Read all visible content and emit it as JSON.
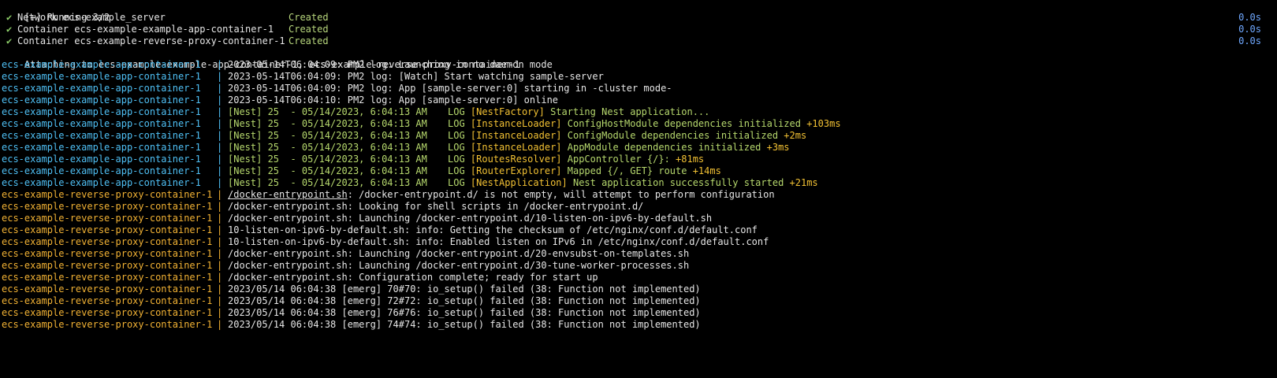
{
  "header": {
    "running": "[+] Running 3/2",
    "items": [
      {
        "check": "✔",
        "label": "Network ecs-example_server",
        "status": "Created",
        "time": "0.0s"
      },
      {
        "check": "✔",
        "label": "Container ecs-example-example-app-container-1",
        "status": "Created",
        "time": "0.0s"
      },
      {
        "check": "✔",
        "label": "Container ecs-example-reverse-proxy-container-1",
        "status": "Created",
        "time": "0.0s"
      }
    ],
    "attaching": "Attaching to ecs-example-example-app-container-1, ecs-example-reverse-proxy-container-1"
  },
  "app": {
    "container": "ecs-example-example-app-container-1",
    "pm2": [
      "2023-05-14T06:04:09: PM2 log: Launching in no daemon mode",
      "2023-05-14T06:04:09: PM2 log: [Watch] Start watching sample-server",
      "2023-05-14T06:04:09: PM2 log: App [sample-server:0] starting in -cluster mode-",
      "2023-05-14T06:04:10: PM2 log: App [sample-server:0] online"
    ],
    "nest_prefix": "[Nest] 25  - 05/14/2023, 6:04:13 AM",
    "nest": [
      {
        "level": "LOG",
        "ctx": "[NestFactory]",
        "text": "Starting Nest application...",
        "ms": ""
      },
      {
        "level": "LOG",
        "ctx": "[InstanceLoader]",
        "text": "ConfigHostModule dependencies initialized",
        "ms": "+103ms"
      },
      {
        "level": "LOG",
        "ctx": "[InstanceLoader]",
        "text": "ConfigModule dependencies initialized",
        "ms": "+2ms"
      },
      {
        "level": "LOG",
        "ctx": "[InstanceLoader]",
        "text": "AppModule dependencies initialized",
        "ms": "+3ms"
      },
      {
        "level": "LOG",
        "ctx": "[RoutesResolver]",
        "text": "AppController {/}:",
        "ms": "+81ms"
      },
      {
        "level": "LOG",
        "ctx": "[RouterExplorer]",
        "text": "Mapped {/, GET} route",
        "ms": "+14ms"
      },
      {
        "level": "LOG",
        "ctx": "[NestApplication]",
        "text": "Nest application successfully started",
        "ms": "+21ms"
      }
    ]
  },
  "proxy": {
    "container": "ecs-example-reverse-proxy-container-1",
    "first_link": "/docker-entrypoint.sh",
    "first_rest": ": /docker-entrypoint.d/ is not empty, will attempt to perform configuration",
    "lines": [
      "/docker-entrypoint.sh: Looking for shell scripts in /docker-entrypoint.d/",
      "/docker-entrypoint.sh: Launching /docker-entrypoint.d/10-listen-on-ipv6-by-default.sh",
      "10-listen-on-ipv6-by-default.sh: info: Getting the checksum of /etc/nginx/conf.d/default.conf",
      "10-listen-on-ipv6-by-default.sh: info: Enabled listen on IPv6 in /etc/nginx/conf.d/default.conf",
      "/docker-entrypoint.sh: Launching /docker-entrypoint.d/20-envsubst-on-templates.sh",
      "/docker-entrypoint.sh: Launching /docker-entrypoint.d/30-tune-worker-processes.sh",
      "/docker-entrypoint.sh: Configuration complete; ready for start up",
      "2023/05/14 06:04:38 [emerg] 70#70: io_setup() failed (38: Function not implemented)",
      "2023/05/14 06:04:38 [emerg] 72#72: io_setup() failed (38: Function not implemented)",
      "2023/05/14 06:04:38 [emerg] 76#76: io_setup() failed (38: Function not implemented)",
      "2023/05/14 06:04:38 [emerg] 74#74: io_setup() failed (38: Function not implemented)"
    ]
  },
  "separator": "|"
}
